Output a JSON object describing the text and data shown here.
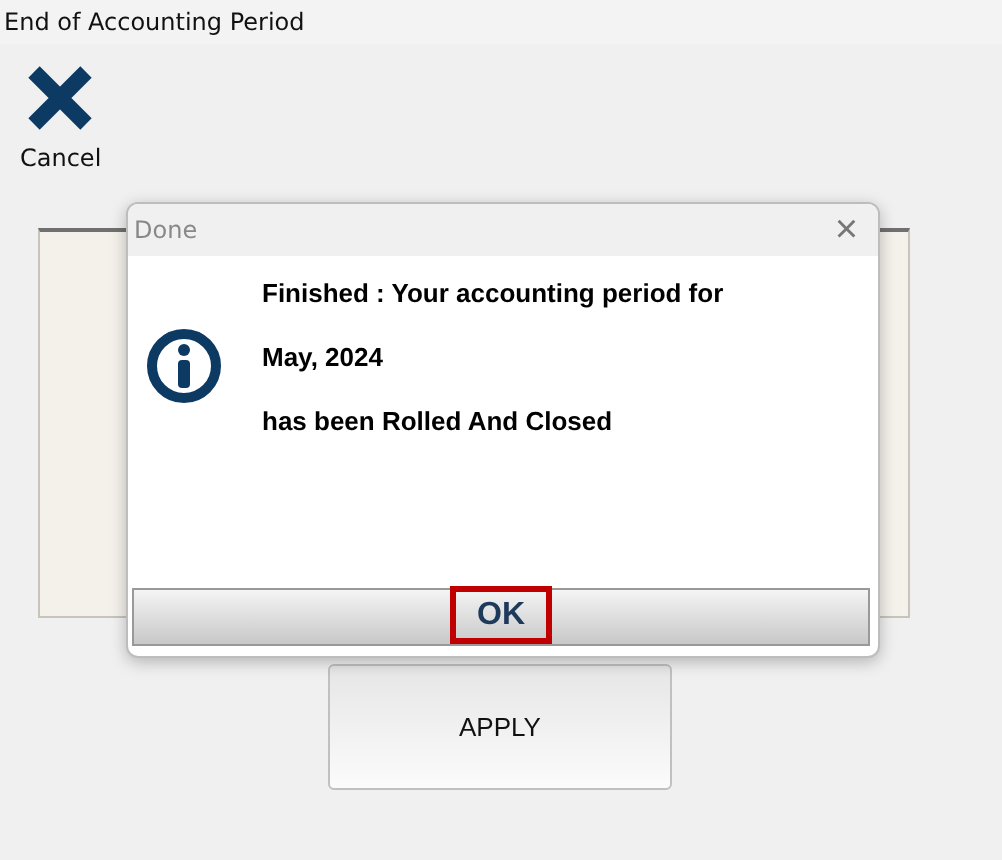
{
  "window": {
    "title": "End of Accounting Period"
  },
  "toolbar": [
    {
      "label": "Cancel",
      "kind": "cancel"
    }
  ],
  "apply_button": {
    "label": "APPLY"
  },
  "dialog": {
    "title": "Done",
    "close": "×",
    "message_lines": [
      "Finished : Your accounting period for",
      "May, 2024",
      "has been Rolled And Closed"
    ],
    "ok_button": {
      "label": "OK",
      "highlighted": true
    }
  }
}
